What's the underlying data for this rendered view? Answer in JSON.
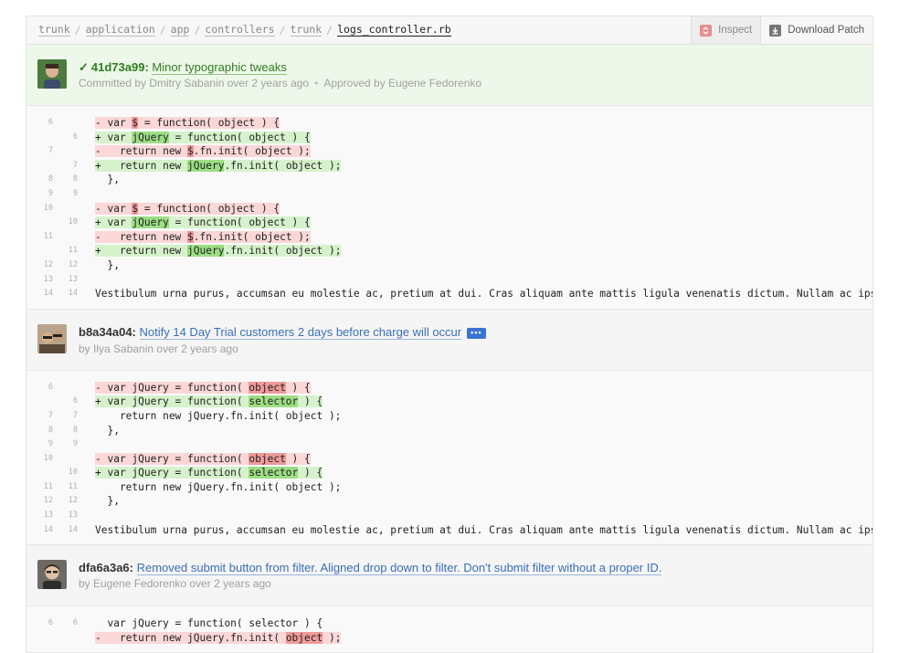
{
  "breadcrumb": [
    "trunk",
    "application",
    "app",
    "controllers",
    "trunk"
  ],
  "current_file": "logs_controller.rb",
  "toolbar": {
    "inspect_label": "Inspect",
    "download_label": "Download Patch"
  },
  "commits": [
    {
      "sha": "41d73a99:",
      "message": "Minor typographic tweaks",
      "meta_author": "Committed by Dmitry Sabanin over 2 years ago",
      "meta_approval": "Approved by Eugene Fedorenko",
      "approved": true
    },
    {
      "sha": "b8a34a04:",
      "message": "Notify 14 Day Trial customers 2 days before charge will occur",
      "meta_author": "by Ilya Sabanin over 2 years ago",
      "badge": "•••"
    },
    {
      "sha": "dfa6a3a6:",
      "message": "Removed submit button from filter. Aligned drop down to filter. Don't submit filter without a proper ID.",
      "meta_author": "by Eugene Fedorenko over 2 years ago"
    }
  ],
  "diff1": [
    {
      "a": "6",
      "b": "",
      "type": "del",
      "pre": "- var ",
      "hl": "$",
      "post": " = function( object ) {"
    },
    {
      "a": "",
      "b": "6",
      "type": "add",
      "pre": "+ var ",
      "hl": "jQuery",
      "post": " = function( object ) {"
    },
    {
      "a": "7",
      "b": "",
      "type": "del",
      "pre": "-   return new ",
      "hl": "$",
      "post": ".fn.init( object );"
    },
    {
      "a": "",
      "b": "7",
      "type": "add",
      "pre": "+   return new ",
      "hl": "jQuery",
      "post": ".fn.init( object );"
    },
    {
      "a": "8",
      "b": "8",
      "type": "ctx",
      "pre": "  },",
      "hl": "",
      "post": ""
    },
    {
      "a": "9",
      "b": "9",
      "type": "ctx",
      "pre": "",
      "hl": "",
      "post": ""
    },
    {
      "a": "10",
      "b": "",
      "type": "del",
      "pre": "- var ",
      "hl": "$",
      "post": " = function( object ) {"
    },
    {
      "a": "",
      "b": "10",
      "type": "add",
      "pre": "+ var ",
      "hl": "jQuery",
      "post": " = function( object ) {"
    },
    {
      "a": "11",
      "b": "",
      "type": "del",
      "pre": "-   return new ",
      "hl": "$",
      "post": ".fn.init( object );"
    },
    {
      "a": "",
      "b": "11",
      "type": "add",
      "pre": "+   return new ",
      "hl": "jQuery",
      "post": ".fn.init( object );"
    },
    {
      "a": "12",
      "b": "12",
      "type": "ctx",
      "pre": "  },",
      "hl": "",
      "post": ""
    },
    {
      "a": "13",
      "b": "13",
      "type": "ctx",
      "pre": "",
      "hl": "",
      "post": ""
    },
    {
      "a": "14",
      "b": "14",
      "type": "ctx",
      "pre": "Vestibulum urna purus, accumsan eu molestie ac, pretium at dui. Cras aliquam ante mattis ligula venenatis dictum. Nullam ac ipsum ac",
      "hl": "",
      "post": ""
    }
  ],
  "diff2": [
    {
      "a": "6",
      "b": "",
      "type": "del",
      "pre": "- var jQuery = function( ",
      "hl": "object",
      "post": " ) {"
    },
    {
      "a": "",
      "b": "6",
      "type": "add",
      "pre": "+ var jQuery = function( ",
      "hl": "selector",
      "post": " ) {"
    },
    {
      "a": "7",
      "b": "7",
      "type": "ctx",
      "pre": "    return new jQuery.fn.init( object );",
      "hl": "",
      "post": ""
    },
    {
      "a": "8",
      "b": "8",
      "type": "ctx",
      "pre": "  },",
      "hl": "",
      "post": ""
    },
    {
      "a": "9",
      "b": "9",
      "type": "ctx",
      "pre": "",
      "hl": "",
      "post": ""
    },
    {
      "a": "10",
      "b": "",
      "type": "del",
      "pre": "- var jQuery = function( ",
      "hl": "object",
      "post": " ) {"
    },
    {
      "a": "",
      "b": "10",
      "type": "add",
      "pre": "+ var jQuery = function( ",
      "hl": "selector",
      "post": " ) {"
    },
    {
      "a": "11",
      "b": "11",
      "type": "ctx",
      "pre": "    return new jQuery.fn.init( object );",
      "hl": "",
      "post": ""
    },
    {
      "a": "12",
      "b": "12",
      "type": "ctx",
      "pre": "  },",
      "hl": "",
      "post": ""
    },
    {
      "a": "13",
      "b": "13",
      "type": "ctx",
      "pre": "",
      "hl": "",
      "post": ""
    },
    {
      "a": "14",
      "b": "14",
      "type": "ctx",
      "pre": "Vestibulum urna purus, accumsan eu molestie ac, pretium at dui. Cras aliquam ante mattis ligula venenatis dictum. Nullam ac ipsum ac",
      "hl": "",
      "post": ""
    }
  ],
  "diff3": [
    {
      "a": "6",
      "b": "6",
      "type": "ctx",
      "pre": "  var jQuery = function( selector ) {",
      "hl": "",
      "post": ""
    },
    {
      "a": "",
      "b": "",
      "type": "del",
      "pre": "-   return new jQuery.fn.init( ",
      "hl": "object",
      "post": " );"
    }
  ],
  "colors": {
    "approved_bg": "#eef8ea",
    "link": "#3a6fb5",
    "approved_text": "#2e7d1e",
    "del_bg": "#fbd7d7",
    "add_bg": "#d6f2cc"
  }
}
